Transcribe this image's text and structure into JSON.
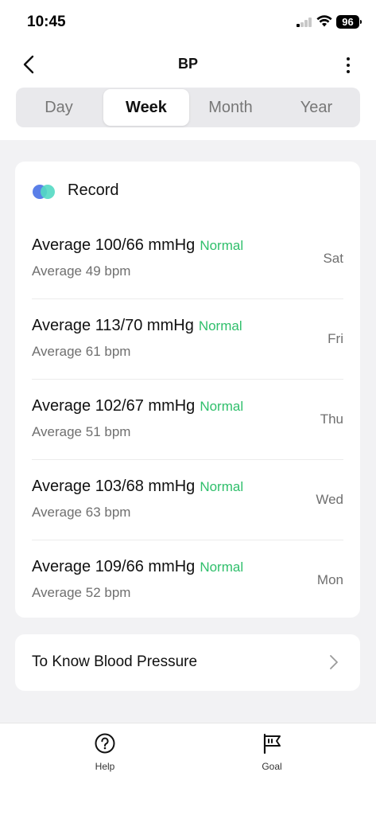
{
  "status_bar": {
    "time": "10:45",
    "battery": "96",
    "icons": [
      "signal-icon",
      "wifi-icon",
      "battery-icon"
    ]
  },
  "header": {
    "title": "BP",
    "back_icon": "chevron-left-icon",
    "more_icon": "more-vertical-icon"
  },
  "tabs": [
    {
      "label": "Day",
      "active": false
    },
    {
      "label": "Week",
      "active": true
    },
    {
      "label": "Month",
      "active": false
    },
    {
      "label": "Year",
      "active": false
    }
  ],
  "record": {
    "title": "Record",
    "items": [
      {
        "bp": "Average 100/66 mmHg",
        "status": "Normal",
        "hr": "Average 49 bpm",
        "day": "Sat"
      },
      {
        "bp": "Average 113/70 mmHg",
        "status": "Normal",
        "hr": "Average 61 bpm",
        "day": "Fri"
      },
      {
        "bp": "Average 102/67 mmHg",
        "status": "Normal",
        "hr": "Average 51 bpm",
        "day": "Thu"
      },
      {
        "bp": "Average 103/68 mmHg",
        "status": "Normal",
        "hr": "Average 63 bpm",
        "day": "Wed"
      },
      {
        "bp": "Average 109/66 mmHg",
        "status": "Normal",
        "hr": "Average 52 bpm",
        "day": "Mon"
      }
    ]
  },
  "know": {
    "label": "To Know Blood Pressure",
    "icon": "chevron-right-icon"
  },
  "bottom_nav": [
    {
      "label": "Help",
      "icon": "help-circle-icon"
    },
    {
      "label": "Goal",
      "icon": "flag-icon"
    }
  ],
  "colors": {
    "status_normal": "#2fbf6b",
    "accent_blue": "#5a7fe8",
    "accent_teal": "#53d9c3"
  }
}
